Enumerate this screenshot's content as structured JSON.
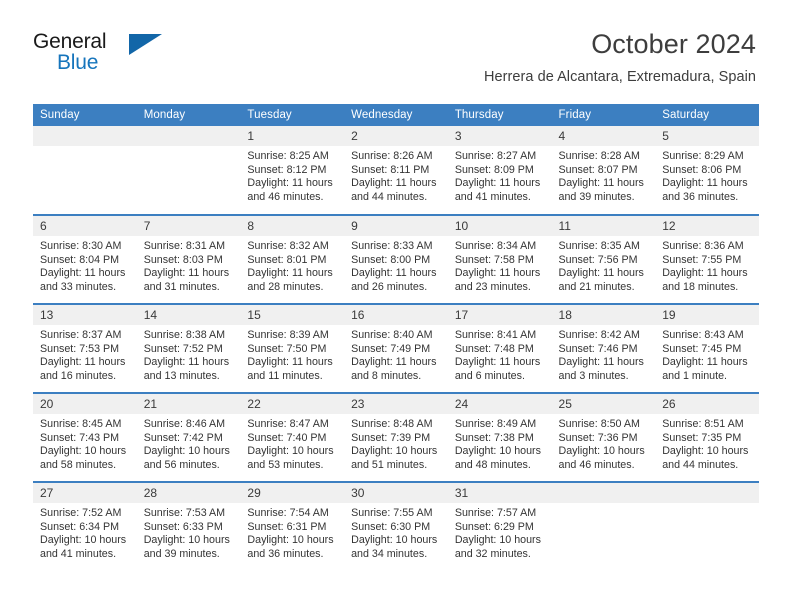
{
  "brand": {
    "name_top": "General",
    "name_bottom": "Blue",
    "accent_color": "#1675bc",
    "triangle_color": "#1266a8"
  },
  "header": {
    "month_title": "October 2024",
    "location": "Herrera de Alcantara, Extremadura, Spain",
    "header_bg": "#3c7fc1",
    "daynum_bg": "#f0f0f0"
  },
  "weekdays": [
    "Sunday",
    "Monday",
    "Tuesday",
    "Wednesday",
    "Thursday",
    "Friday",
    "Saturday"
  ],
  "labels": {
    "sunrise_prefix": "Sunrise:",
    "sunset_prefix": "Sunset:",
    "daylight_prefix": "Daylight:"
  },
  "weeks": [
    [
      {
        "empty": true
      },
      {
        "empty": true
      },
      {
        "day": "1",
        "sunrise": "Sunrise: 8:25 AM",
        "sunset": "Sunset: 8:12 PM",
        "daylight": "Daylight: 11 hours and 46 minutes."
      },
      {
        "day": "2",
        "sunrise": "Sunrise: 8:26 AM",
        "sunset": "Sunset: 8:11 PM",
        "daylight": "Daylight: 11 hours and 44 minutes."
      },
      {
        "day": "3",
        "sunrise": "Sunrise: 8:27 AM",
        "sunset": "Sunset: 8:09 PM",
        "daylight": "Daylight: 11 hours and 41 minutes."
      },
      {
        "day": "4",
        "sunrise": "Sunrise: 8:28 AM",
        "sunset": "Sunset: 8:07 PM",
        "daylight": "Daylight: 11 hours and 39 minutes."
      },
      {
        "day": "5",
        "sunrise": "Sunrise: 8:29 AM",
        "sunset": "Sunset: 8:06 PM",
        "daylight": "Daylight: 11 hours and 36 minutes."
      }
    ],
    [
      {
        "day": "6",
        "sunrise": "Sunrise: 8:30 AM",
        "sunset": "Sunset: 8:04 PM",
        "daylight": "Daylight: 11 hours and 33 minutes."
      },
      {
        "day": "7",
        "sunrise": "Sunrise: 8:31 AM",
        "sunset": "Sunset: 8:03 PM",
        "daylight": "Daylight: 11 hours and 31 minutes."
      },
      {
        "day": "8",
        "sunrise": "Sunrise: 8:32 AM",
        "sunset": "Sunset: 8:01 PM",
        "daylight": "Daylight: 11 hours and 28 minutes."
      },
      {
        "day": "9",
        "sunrise": "Sunrise: 8:33 AM",
        "sunset": "Sunset: 8:00 PM",
        "daylight": "Daylight: 11 hours and 26 minutes."
      },
      {
        "day": "10",
        "sunrise": "Sunrise: 8:34 AM",
        "sunset": "Sunset: 7:58 PM",
        "daylight": "Daylight: 11 hours and 23 minutes."
      },
      {
        "day": "11",
        "sunrise": "Sunrise: 8:35 AM",
        "sunset": "Sunset: 7:56 PM",
        "daylight": "Daylight: 11 hours and 21 minutes."
      },
      {
        "day": "12",
        "sunrise": "Sunrise: 8:36 AM",
        "sunset": "Sunset: 7:55 PM",
        "daylight": "Daylight: 11 hours and 18 minutes."
      }
    ],
    [
      {
        "day": "13",
        "sunrise": "Sunrise: 8:37 AM",
        "sunset": "Sunset: 7:53 PM",
        "daylight": "Daylight: 11 hours and 16 minutes."
      },
      {
        "day": "14",
        "sunrise": "Sunrise: 8:38 AM",
        "sunset": "Sunset: 7:52 PM",
        "daylight": "Daylight: 11 hours and 13 minutes."
      },
      {
        "day": "15",
        "sunrise": "Sunrise: 8:39 AM",
        "sunset": "Sunset: 7:50 PM",
        "daylight": "Daylight: 11 hours and 11 minutes."
      },
      {
        "day": "16",
        "sunrise": "Sunrise: 8:40 AM",
        "sunset": "Sunset: 7:49 PM",
        "daylight": "Daylight: 11 hours and 8 minutes."
      },
      {
        "day": "17",
        "sunrise": "Sunrise: 8:41 AM",
        "sunset": "Sunset: 7:48 PM",
        "daylight": "Daylight: 11 hours and 6 minutes."
      },
      {
        "day": "18",
        "sunrise": "Sunrise: 8:42 AM",
        "sunset": "Sunset: 7:46 PM",
        "daylight": "Daylight: 11 hours and 3 minutes."
      },
      {
        "day": "19",
        "sunrise": "Sunrise: 8:43 AM",
        "sunset": "Sunset: 7:45 PM",
        "daylight": "Daylight: 11 hours and 1 minute."
      }
    ],
    [
      {
        "day": "20",
        "sunrise": "Sunrise: 8:45 AM",
        "sunset": "Sunset: 7:43 PM",
        "daylight": "Daylight: 10 hours and 58 minutes."
      },
      {
        "day": "21",
        "sunrise": "Sunrise: 8:46 AM",
        "sunset": "Sunset: 7:42 PM",
        "daylight": "Daylight: 10 hours and 56 minutes."
      },
      {
        "day": "22",
        "sunrise": "Sunrise: 8:47 AM",
        "sunset": "Sunset: 7:40 PM",
        "daylight": "Daylight: 10 hours and 53 minutes."
      },
      {
        "day": "23",
        "sunrise": "Sunrise: 8:48 AM",
        "sunset": "Sunset: 7:39 PM",
        "daylight": "Daylight: 10 hours and 51 minutes."
      },
      {
        "day": "24",
        "sunrise": "Sunrise: 8:49 AM",
        "sunset": "Sunset: 7:38 PM",
        "daylight": "Daylight: 10 hours and 48 minutes."
      },
      {
        "day": "25",
        "sunrise": "Sunrise: 8:50 AM",
        "sunset": "Sunset: 7:36 PM",
        "daylight": "Daylight: 10 hours and 46 minutes."
      },
      {
        "day": "26",
        "sunrise": "Sunrise: 8:51 AM",
        "sunset": "Sunset: 7:35 PM",
        "daylight": "Daylight: 10 hours and 44 minutes."
      }
    ],
    [
      {
        "day": "27",
        "sunrise": "Sunrise: 7:52 AM",
        "sunset": "Sunset: 6:34 PM",
        "daylight": "Daylight: 10 hours and 41 minutes."
      },
      {
        "day": "28",
        "sunrise": "Sunrise: 7:53 AM",
        "sunset": "Sunset: 6:33 PM",
        "daylight": "Daylight: 10 hours and 39 minutes."
      },
      {
        "day": "29",
        "sunrise": "Sunrise: 7:54 AM",
        "sunset": "Sunset: 6:31 PM",
        "daylight": "Daylight: 10 hours and 36 minutes."
      },
      {
        "day": "30",
        "sunrise": "Sunrise: 7:55 AM",
        "sunset": "Sunset: 6:30 PM",
        "daylight": "Daylight: 10 hours and 34 minutes."
      },
      {
        "day": "31",
        "sunrise": "Sunrise: 7:57 AM",
        "sunset": "Sunset: 6:29 PM",
        "daylight": "Daylight: 10 hours and 32 minutes."
      },
      {
        "empty": true
      },
      {
        "empty": true
      }
    ]
  ]
}
